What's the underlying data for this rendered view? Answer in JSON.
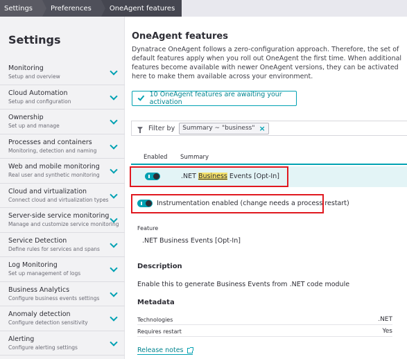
{
  "breadcrumb": [
    "Settings",
    "Preferences",
    "OneAgent features"
  ],
  "sidebar": {
    "title": "Settings",
    "items": [
      {
        "label": "Monitoring",
        "sub": "Setup and overview"
      },
      {
        "label": "Cloud Automation",
        "sub": "Setup and configuration"
      },
      {
        "label": "Ownership",
        "sub": "Set up and manage"
      },
      {
        "label": "Processes and containers",
        "sub": "Monitoring, detection and naming"
      },
      {
        "label": "Web and mobile monitoring",
        "sub": "Real user and synthetic monitoring"
      },
      {
        "label": "Cloud and virtualization",
        "sub": "Connect cloud and virtualization types"
      },
      {
        "label": "Server-side service monitoring",
        "sub": "Manage and customize service monitoring"
      },
      {
        "label": "Service Detection",
        "sub": "Define rules for services and spans"
      },
      {
        "label": "Log Monitoring",
        "sub": "Set up management of logs"
      },
      {
        "label": "Business Analytics",
        "sub": "Configure business events settings"
      },
      {
        "label": "Anomaly detection",
        "sub": "Configure detection sensitivity"
      },
      {
        "label": "Alerting",
        "sub": "Configure alerting settings"
      }
    ]
  },
  "main": {
    "title": "OneAgent features",
    "description": "Dynatrace OneAgent follows a zero-configuration approach. Therefore, the set of default features apply when you roll out OneAgent the first time. When additional features become available with newer OneAgent versions, they can be activated here to make them available across your environment.",
    "activation_button": "10 OneAgent features are awaiting your activation",
    "filter": {
      "label": "Filter by",
      "chip": "Summary ~ \"business\""
    },
    "table": {
      "headers": {
        "enabled": "Enabled",
        "summary": "Summary"
      },
      "row": {
        "prefix": ".NET ",
        "highlight": "Business",
        "suffix": " Events [Opt-In]",
        "enabled": true
      }
    },
    "instrumentation": {
      "label": "Instrumentation enabled (change needs a process restart)",
      "enabled": true
    },
    "feature": {
      "label": "Feature",
      "value": ".NET Business Events [Opt-In]"
    },
    "description_section": {
      "heading": "Description",
      "text": "Enable this to generate Business Events from .NET code module"
    },
    "metadata": {
      "heading": "Metadata",
      "rows": [
        {
          "key": "Technologies",
          "value": ".NET"
        },
        {
          "key": "Requires restart",
          "value": "Yes"
        }
      ]
    },
    "release_notes": "Release notes"
  },
  "colors": {
    "accent": "#00a1b2",
    "highlight_box": "#e0181f",
    "search_highlight": "#f5e26b",
    "row_bg": "#e3f4f6"
  }
}
